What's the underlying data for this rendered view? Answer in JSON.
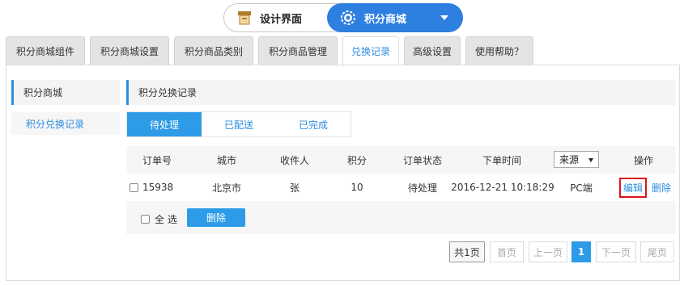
{
  "top_toggle": {
    "design_label": "设计界面",
    "mall_label": "积分商城"
  },
  "tabs": [
    {
      "label": "积分商城组件"
    },
    {
      "label": "积分商城设置"
    },
    {
      "label": "积分商品类别"
    },
    {
      "label": "积分商品管理"
    },
    {
      "label": "兑换记录",
      "active": true
    },
    {
      "label": "高级设置"
    },
    {
      "label": "使用帮助？"
    }
  ],
  "sidebar": {
    "title": "积分商城",
    "items": [
      {
        "label": "积分兑换记录"
      }
    ]
  },
  "main": {
    "title": "积分兑换记录",
    "status_tabs": [
      {
        "label": "待处理",
        "active": true
      },
      {
        "label": "已配送"
      },
      {
        "label": "已完成"
      }
    ]
  },
  "table": {
    "headers": {
      "order_no": "订单号",
      "city": "城市",
      "recipient": "收件人",
      "points": "积分",
      "status": "订单状态",
      "time": "下单时间",
      "source_select": "来源",
      "actions": "操作"
    },
    "rows": [
      {
        "order_no": "15938",
        "city": "北京市",
        "recipient": "张",
        "points": "10",
        "status": "待处理",
        "time": "2016-12-21 10:18:29",
        "source": "PC端",
        "edit": "编辑",
        "delete": "删除"
      }
    ],
    "select_all": "全 选",
    "bulk_delete": "删除"
  },
  "pagination": {
    "total": "共1页",
    "first": "首页",
    "prev": "上一页",
    "current": "1",
    "next": "下一页",
    "last": "尾页"
  },
  "colors": {
    "accent": "#2d8de0",
    "highlight_border": "#e0141e"
  }
}
